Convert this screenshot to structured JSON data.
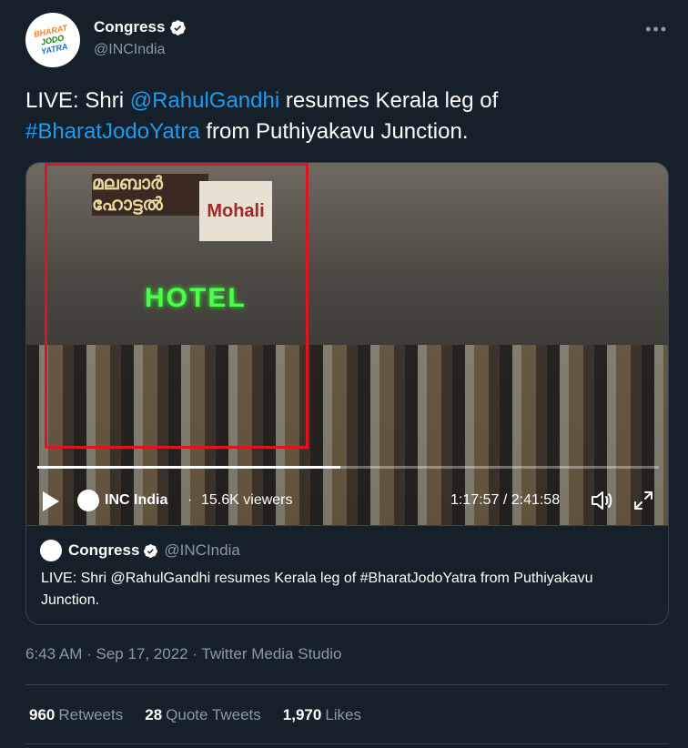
{
  "header": {
    "display_name": "Congress",
    "handle": "@INCIndia",
    "avatar_logo": [
      "BHARAT",
      "JODO",
      "YATRA"
    ],
    "verified_icon": "verified-badge-icon",
    "more_icon": "more-horizontal-icon"
  },
  "tweet": {
    "prefix": "LIVE: Shri ",
    "mention": "@RahulGandhi",
    "middle": " resumes Kerala leg of",
    "hashtag": "#BharatJodoYatra",
    "suffix": " from Puthiyakavu Junction."
  },
  "video": {
    "scene_signs": {
      "malayalam": "മലബാർ ഹോട്ടൽ",
      "mohali": "Mohali",
      "hotel": "HOTEL"
    },
    "channel": "INC India",
    "separator": "·",
    "viewers": "15.6K viewers",
    "time": "1:17:57 / 2:41:58",
    "progress_fraction": 0.488,
    "highlight_color": "#e0141e",
    "icons": [
      "play-icon",
      "volume-icon",
      "fullscreen-icon"
    ]
  },
  "quote": {
    "display_name": "Congress",
    "handle": "@INCIndia",
    "text": "LIVE: Shri @RahulGandhi resumes Kerala leg of #BharatJodoYatra from Puthiyakavu Junction."
  },
  "meta": {
    "text": "6:43 AM · Sep 17, 2022 · Twitter Media Studio"
  },
  "stats": {
    "retweets_count": "960",
    "retweets_label": "Retweets",
    "quotes_count": "28",
    "quotes_label": "Quote Tweets",
    "likes_count": "1,970",
    "likes_label": "Likes"
  },
  "colors": {
    "background": "#15202b",
    "link": "#1d9bf0",
    "secondary_text": "#8b98a5",
    "border": "#38444d"
  }
}
